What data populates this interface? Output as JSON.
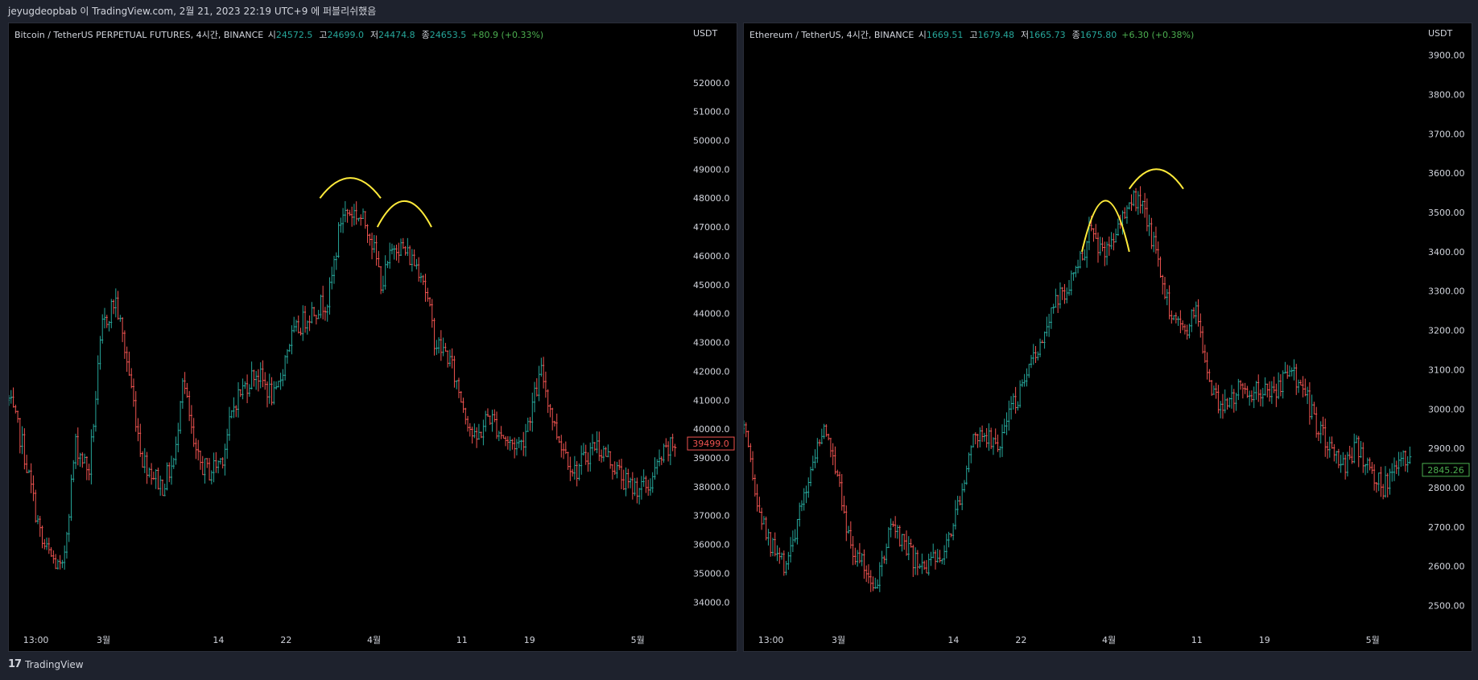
{
  "topbar": {
    "text": "jeyugdeopbab 이 TradingView.com, 2월 21, 2023 22:19 UTC+9 에 퍼블리쉬했음"
  },
  "footer": {
    "logo": "17",
    "brand": "TradingView"
  },
  "colors": {
    "up": "#26a69a",
    "down": "#ef5350",
    "annotation": "#ffeb3b",
    "axis_text": "#d1d4dc"
  },
  "chart_data": [
    {
      "type": "candlestick",
      "symbol": "Bitcoin / TetherUS PERPETUAL FUTURES, 4시간, BINANCE",
      "ohlc_labels": {
        "o_label": "시",
        "o": "24572.5",
        "h_label": "고",
        "h": "24699.0",
        "l_label": "저",
        "l": "24474.8",
        "c_label": "종",
        "c": "24653.5",
        "chg": "+80.9 (+0.33%)"
      },
      "currency": "USDT",
      "ylim": [
        33200,
        53500
      ],
      "y_ticks": [
        "52000.0",
        "51000.0",
        "50000.0",
        "49000.0",
        "48000.0",
        "47000.0",
        "46000.0",
        "45000.0",
        "44000.0",
        "43000.0",
        "42000.0",
        "41000.0",
        "40000.0",
        "39000.0",
        "38000.0",
        "37000.0",
        "36000.0",
        "35000.0",
        "34000.0"
      ],
      "x_ticks": [
        [
          "13:00",
          0.04
        ],
        [
          "3월",
          0.14
        ],
        [
          "14",
          0.31
        ],
        [
          "22",
          0.41
        ],
        [
          "4월",
          0.54
        ],
        [
          "11",
          0.67
        ],
        [
          "19",
          0.77
        ],
        [
          "5월",
          0.93
        ]
      ],
      "last_price": "39499.0",
      "last_price_color": "#ef5350",
      "path_points": [
        [
          0,
          41000
        ],
        [
          0.02,
          39500
        ],
        [
          0.05,
          36000
        ],
        [
          0.08,
          35000
        ],
        [
          0.1,
          39500
        ],
        [
          0.12,
          38500
        ],
        [
          0.14,
          43500
        ],
        [
          0.16,
          44500
        ],
        [
          0.18,
          42000
        ],
        [
          0.2,
          39000
        ],
        [
          0.23,
          38000
        ],
        [
          0.25,
          39000
        ],
        [
          0.26,
          42000
        ],
        [
          0.28,
          39000
        ],
        [
          0.3,
          38500
        ],
        [
          0.32,
          39000
        ],
        [
          0.34,
          41000
        ],
        [
          0.37,
          42000
        ],
        [
          0.4,
          41000
        ],
        [
          0.42,
          43000
        ],
        [
          0.45,
          44000
        ],
        [
          0.48,
          44500
        ],
        [
          0.5,
          47500
        ],
        [
          0.52,
          47500
        ],
        [
          0.54,
          47000
        ],
        [
          0.56,
          45000
        ],
        [
          0.58,
          46500
        ],
        [
          0.6,
          46000
        ],
        [
          0.62,
          45500
        ],
        [
          0.64,
          43000
        ],
        [
          0.66,
          42500
        ],
        [
          0.68,
          41000
        ],
        [
          0.7,
          39500
        ],
        [
          0.72,
          40500
        ],
        [
          0.75,
          39500
        ],
        [
          0.77,
          39500
        ],
        [
          0.8,
          42000
        ],
        [
          0.82,
          40000
        ],
        [
          0.85,
          38500
        ],
        [
          0.88,
          39500
        ],
        [
          0.9,
          39000
        ],
        [
          0.93,
          38000
        ],
        [
          0.96,
          38000
        ],
        [
          0.98,
          39000
        ],
        [
          1.0,
          39500
        ]
      ],
      "annotations": [
        {
          "type": "arc",
          "x0": 0.46,
          "x1": 0.55,
          "y_base": 48000,
          "y_peak": 48700
        },
        {
          "type": "arc",
          "x0": 0.545,
          "x1": 0.625,
          "y_base": 47000,
          "y_peak": 47900
        }
      ]
    },
    {
      "type": "candlestick",
      "symbol": "Ethereum / TetherUS, 4시간, BINANCE",
      "ohlc_labels": {
        "o_label": "시",
        "o": "1669.51",
        "h_label": "고",
        "h": "1679.48",
        "l_label": "저",
        "l": "1665.73",
        "c_label": "종",
        "c": "1675.80",
        "chg": "+6.30 (+0.38%)"
      },
      "currency": "USDT",
      "ylim": [
        2450,
        3940
      ],
      "y_ticks": [
        "3900.00",
        "3800.00",
        "3700.00",
        "3600.00",
        "3500.00",
        "3400.00",
        "3300.00",
        "3200.00",
        "3100.00",
        "3000.00",
        "2900.00",
        "2800.00",
        "2700.00",
        "2600.00",
        "2500.00"
      ],
      "x_ticks": [
        [
          "13:00",
          0.04
        ],
        [
          "3월",
          0.14
        ],
        [
          "14",
          0.31
        ],
        [
          "22",
          0.41
        ],
        [
          "4월",
          0.54
        ],
        [
          "11",
          0.67
        ],
        [
          "19",
          0.77
        ],
        [
          "5월",
          0.93
        ]
      ],
      "last_price": "2845.26",
      "last_price_color": "#4caf50",
      "path_points": [
        [
          0,
          2950
        ],
        [
          0.02,
          2750
        ],
        [
          0.04,
          2650
        ],
        [
          0.06,
          2600
        ],
        [
          0.08,
          2700
        ],
        [
          0.1,
          2850
        ],
        [
          0.12,
          2950
        ],
        [
          0.14,
          2850
        ],
        [
          0.16,
          2650
        ],
        [
          0.18,
          2600
        ],
        [
          0.2,
          2550
        ],
        [
          0.22,
          2700
        ],
        [
          0.24,
          2650
        ],
        [
          0.26,
          2600
        ],
        [
          0.28,
          2600
        ],
        [
          0.3,
          2650
        ],
        [
          0.32,
          2750
        ],
        [
          0.34,
          2900
        ],
        [
          0.36,
          2950
        ],
        [
          0.38,
          2900
        ],
        [
          0.4,
          3000
        ],
        [
          0.42,
          3050
        ],
        [
          0.44,
          3150
        ],
        [
          0.46,
          3250
        ],
        [
          0.48,
          3300
        ],
        [
          0.5,
          3350
        ],
        [
          0.52,
          3450
        ],
        [
          0.54,
          3400
        ],
        [
          0.56,
          3450
        ],
        [
          0.58,
          3550
        ],
        [
          0.6,
          3500
        ],
        [
          0.62,
          3400
        ],
        [
          0.64,
          3250
        ],
        [
          0.66,
          3200
        ],
        [
          0.68,
          3250
        ],
        [
          0.7,
          3050
        ],
        [
          0.72,
          3000
        ],
        [
          0.74,
          3050
        ],
        [
          0.76,
          3050
        ],
        [
          0.78,
          3050
        ],
        [
          0.8,
          3050
        ],
        [
          0.82,
          3100
        ],
        [
          0.84,
          3050
        ],
        [
          0.86,
          2950
        ],
        [
          0.88,
          2900
        ],
        [
          0.9,
          2850
        ],
        [
          0.92,
          2900
        ],
        [
          0.94,
          2850
        ],
        [
          0.96,
          2800
        ],
        [
          0.98,
          2850
        ],
        [
          1.0,
          2880
        ]
      ],
      "annotations": [
        {
          "type": "arc",
          "x0": 0.5,
          "x1": 0.57,
          "y_base": 3400,
          "y_peak": 3530
        },
        {
          "type": "arc",
          "x0": 0.57,
          "x1": 0.65,
          "y_base": 3560,
          "y_peak": 3610
        }
      ]
    }
  ]
}
